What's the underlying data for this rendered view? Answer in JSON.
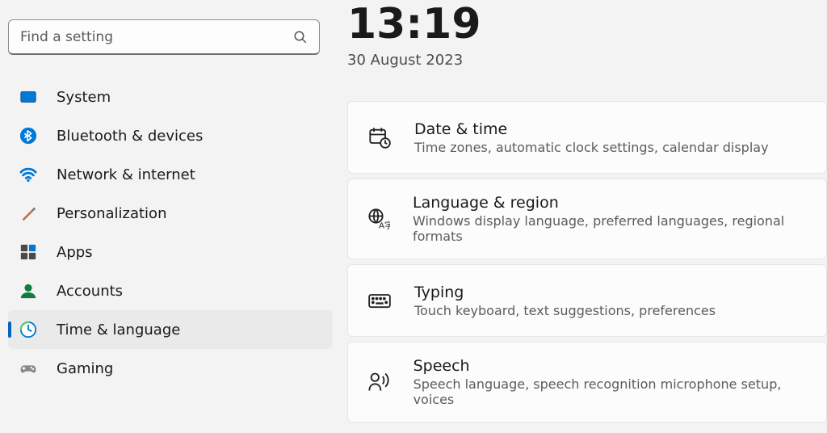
{
  "search": {
    "placeholder": "Find a setting"
  },
  "nav": [
    {
      "label": "System",
      "icon": "system"
    },
    {
      "label": "Bluetooth & devices",
      "icon": "bluetooth"
    },
    {
      "label": "Network & internet",
      "icon": "wifi"
    },
    {
      "label": "Personalization",
      "icon": "brush"
    },
    {
      "label": "Apps",
      "icon": "apps"
    },
    {
      "label": "Accounts",
      "icon": "account"
    },
    {
      "label": "Time & language",
      "icon": "clock"
    },
    {
      "label": "Gaming",
      "icon": "gaming"
    }
  ],
  "nav_selected_index": 6,
  "clock": {
    "time": "13:19",
    "date": "30 August 2023"
  },
  "cards": [
    {
      "title": "Date & time",
      "sub": "Time zones, automatic clock settings, calendar display",
      "icon": "datetime"
    },
    {
      "title": "Language & region",
      "sub": "Windows display language, preferred languages, regional formats",
      "icon": "language"
    },
    {
      "title": "Typing",
      "sub": "Touch keyboard, text suggestions, preferences",
      "icon": "keyboard"
    },
    {
      "title": "Speech",
      "sub": "Speech language, speech recognition microphone setup, voices",
      "icon": "speech"
    }
  ]
}
